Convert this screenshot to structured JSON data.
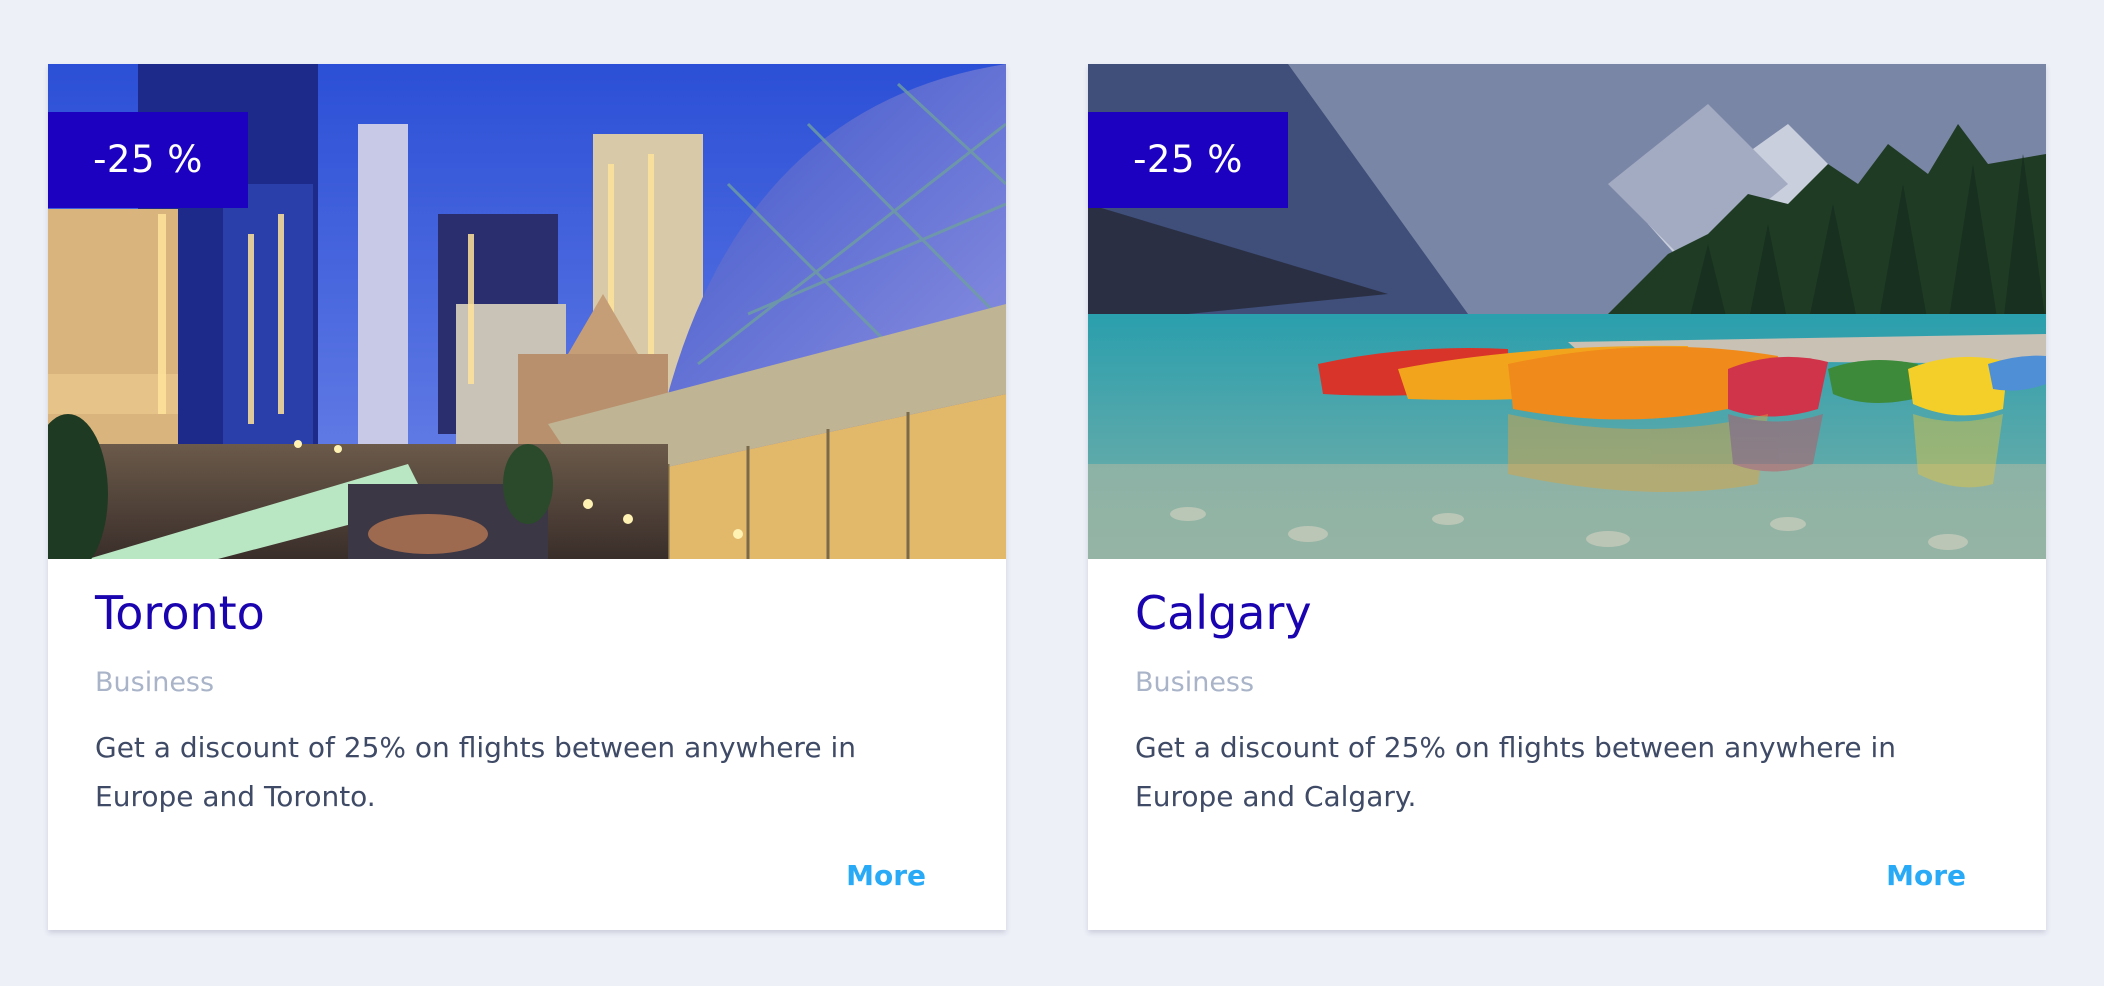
{
  "cards": [
    {
      "badge": "-25 %",
      "title": "Toronto",
      "category": "Business",
      "description": "Get a discount of 25% on flights between anywhere in Europe and Toronto.",
      "more_label": "More",
      "image": "toronto-city-night-photo"
    },
    {
      "badge": "-25 %",
      "title": "Calgary",
      "category": "Business",
      "description": "Get a discount of 25% on flights between anywhere in Europe and Calgary.",
      "more_label": "More",
      "image": "lake-canoes-mountains-photo"
    }
  ],
  "colors": {
    "page_bg": "#eef0f8",
    "badge_bg": "#1c02c0",
    "title": "#1a04b0",
    "category": "#a9b4c9",
    "description": "#3f4b66",
    "link": "#29aaf6"
  }
}
